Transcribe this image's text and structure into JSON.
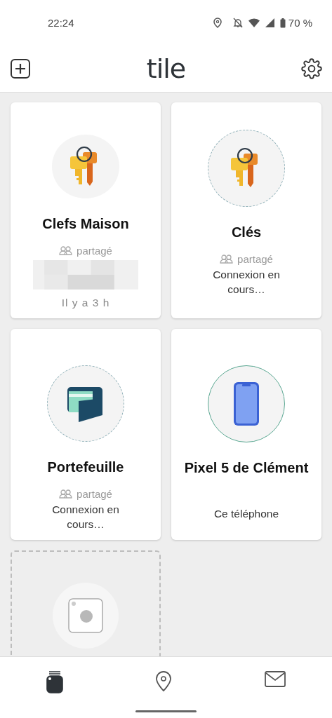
{
  "status_bar": {
    "time": "22:24",
    "battery": "70 %"
  },
  "header": {
    "logo": "tile"
  },
  "cards": [
    {
      "name": "Clefs Maison",
      "kind": "keys",
      "connecting": false,
      "shared": "partagé",
      "redacted": true,
      "status": "Il y a 3 h"
    },
    {
      "name": "Clés",
      "kind": "keys",
      "connecting": true,
      "shared": "partagé",
      "redacted": false,
      "status": "Connexion en cours…"
    },
    {
      "name": "Portefeuille",
      "kind": "wallet",
      "connecting": true,
      "shared": "partagé",
      "redacted": false,
      "status": "Connexion en cours…"
    },
    {
      "name": "Pixel 5 de Clément",
      "kind": "phone",
      "connecting": false,
      "redacted": false,
      "status": "Ce téléphone"
    }
  ],
  "nav": [
    {
      "kind": "tiles",
      "selected": true
    },
    {
      "kind": "map",
      "selected": false
    },
    {
      "kind": "mail",
      "selected": false
    }
  ]
}
